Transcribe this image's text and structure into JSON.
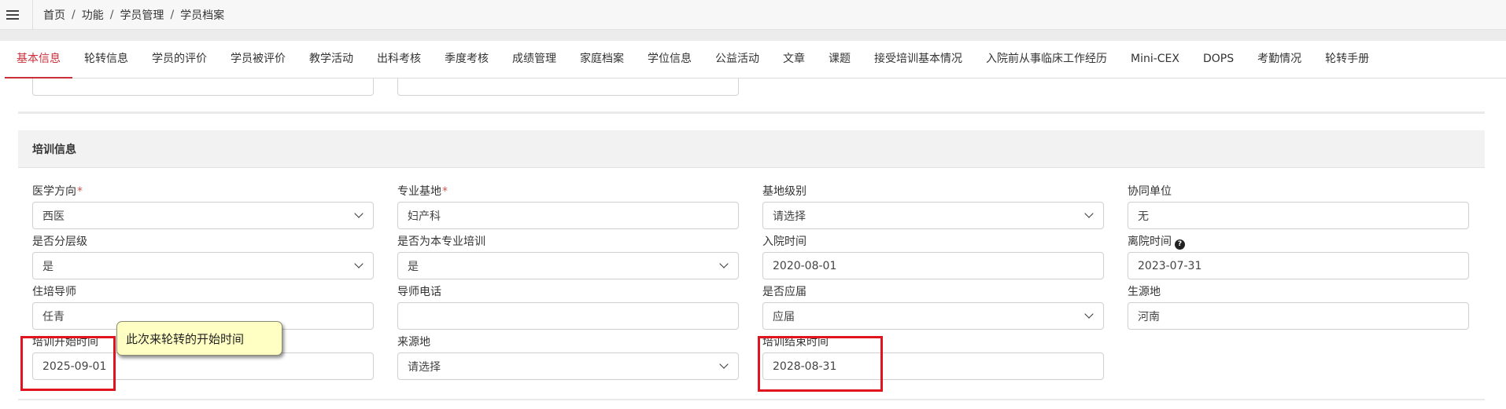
{
  "breadcrumb": [
    "首页",
    "功能",
    "学员管理",
    "学员档案"
  ],
  "breadcrumb_separator": "/",
  "tabs": [
    {
      "label": "基本信息",
      "active": true
    },
    {
      "label": "轮转信息"
    },
    {
      "label": "学员的评价"
    },
    {
      "label": "学员被评价"
    },
    {
      "label": "教学活动"
    },
    {
      "label": "出科考核"
    },
    {
      "label": "季度考核"
    },
    {
      "label": "成绩管理"
    },
    {
      "label": "家庭档案"
    },
    {
      "label": "学位信息"
    },
    {
      "label": "公益活动"
    },
    {
      "label": "文章"
    },
    {
      "label": "课题"
    },
    {
      "label": "接受培训基本情况"
    },
    {
      "label": "入院前从事临床工作经历"
    },
    {
      "label": "Mini-CEX"
    },
    {
      "label": "DOPS"
    },
    {
      "label": "考勤情况"
    },
    {
      "label": "轮转手册"
    }
  ],
  "section": {
    "title": "培训信息"
  },
  "fields": {
    "medical_direction": {
      "label": "医学方向",
      "required": true,
      "value": "西医",
      "type": "select"
    },
    "specialty_base": {
      "label": "专业基地",
      "required": true,
      "value": "妇产科",
      "type": "input"
    },
    "base_level": {
      "label": "基地级别",
      "value": "请选择",
      "type": "select"
    },
    "partner_unit": {
      "label": "协同单位",
      "value": "无",
      "type": "input"
    },
    "is_tiered": {
      "label": "是否分层级",
      "value": "是",
      "type": "select"
    },
    "is_own_specialty": {
      "label": "是否为本专业培训",
      "value": "是",
      "type": "select"
    },
    "admission_date": {
      "label": "入院时间",
      "value": "2020-08-01",
      "type": "input"
    },
    "leave_date": {
      "label": "离院时间",
      "value": "2023-07-31",
      "type": "input",
      "help_icon": "?"
    },
    "tutor": {
      "label": "住培导师",
      "value": "任青",
      "type": "input"
    },
    "tutor_phone": {
      "label": "导师电话",
      "value": "",
      "type": "input"
    },
    "is_fresh_grad": {
      "label": "是否应届",
      "value": "应届",
      "type": "select"
    },
    "origin_place": {
      "label": "生源地",
      "value": "河南",
      "type": "input"
    },
    "train_start": {
      "label": "培训开始时间",
      "value": "2025-09-01",
      "type": "input"
    },
    "source_place": {
      "label": "来源地",
      "value": "请选择",
      "type": "select"
    },
    "train_end": {
      "label": "培训结束时间",
      "value": "2028-08-31",
      "type": "input"
    }
  },
  "annotation": {
    "tooltip_text": "此次来轮转的开始时间",
    "highlight_color": "#e0141e",
    "tooltip_bg": "#ffffc4"
  },
  "colors": {
    "accent": "#c9303a",
    "required": "#d9534f"
  },
  "icons": {
    "menu": "hamburger-icon",
    "select": "chevron-down-icon",
    "help": "question-circle-icon"
  }
}
